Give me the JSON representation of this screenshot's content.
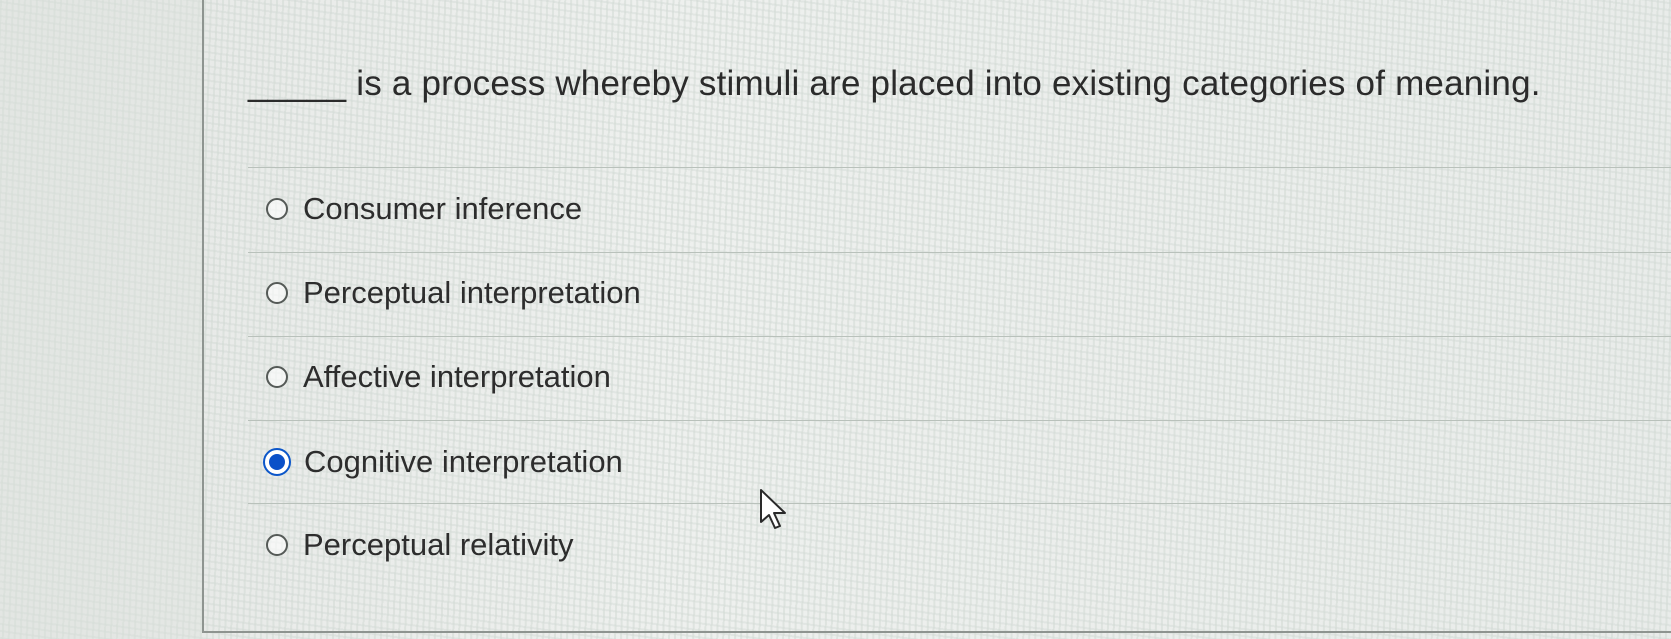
{
  "question": {
    "text": "_____ is a process whereby stimuli are placed into existing categories of meaning."
  },
  "options": [
    {
      "label": "Consumer inference",
      "selected": false
    },
    {
      "label": "Perceptual interpretation",
      "selected": false
    },
    {
      "label": "Affective interpretation",
      "selected": false
    },
    {
      "label": "Cognitive interpretation",
      "selected": true
    },
    {
      "label": "Perceptual relativity",
      "selected": false
    }
  ],
  "colors": {
    "selected_radio": "#0a50c8",
    "text": "#2d2d2d",
    "divider": "#b9c1bb"
  },
  "icons": {
    "cursor": "mouse-pointer-icon"
  }
}
